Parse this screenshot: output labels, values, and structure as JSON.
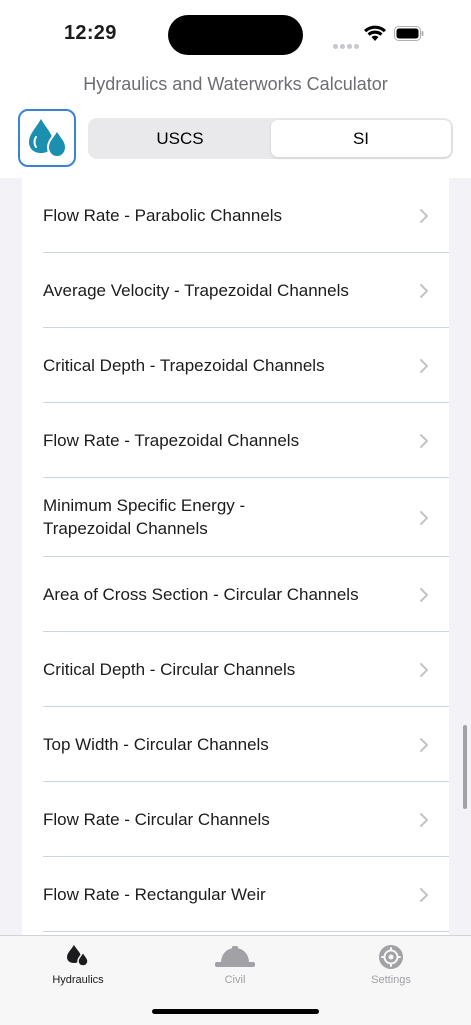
{
  "status_bar": {
    "time": "12:29"
  },
  "header": {
    "title": "Hydraulics and Waterworks Calculator",
    "units_segments": [
      {
        "label": "USCS",
        "selected": false
      },
      {
        "label": "SI",
        "selected": true
      }
    ]
  },
  "list": {
    "items": [
      {
        "label": "Flow Rate - Parabolic Channels"
      },
      {
        "label": "Average Velocity - Trapezoidal Channels"
      },
      {
        "label": "Critical Depth - Trapezoidal Channels"
      },
      {
        "label": "Flow Rate - Trapezoidal Channels"
      },
      {
        "label": "Minimum Specific Energy - Trapezoidal Channels"
      },
      {
        "label": "Area of Cross Section - Circular Channels"
      },
      {
        "label": "Critical Depth - Circular Channels"
      },
      {
        "label": "Top Width - Circular Channels"
      },
      {
        "label": "Flow Rate - Circular Channels"
      },
      {
        "label": "Flow Rate - Rectangular Weir"
      }
    ]
  },
  "tab_bar": {
    "tabs": [
      {
        "label": "Hydraulics",
        "icon": "water-drops-icon",
        "selected": true
      },
      {
        "label": "Civil",
        "icon": "hard-hat-icon",
        "selected": false
      },
      {
        "label": "Settings",
        "icon": "gear-icon",
        "selected": false
      }
    ]
  },
  "colors": {
    "accent": "#3b82d6",
    "logo_drop": "#1a8fb0",
    "separator": "#c6d6e4",
    "background": "#f2f2f7",
    "inactive_tab": "#a1a1a6"
  }
}
